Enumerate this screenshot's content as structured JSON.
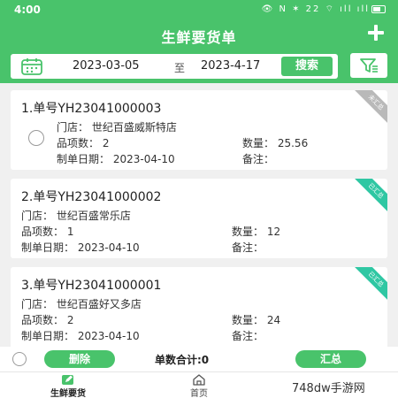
{
  "status_bar": {
    "time": "4:00",
    "icons_text": "👁 N ✶ 22 ⌔ ıll ıll"
  },
  "header": {
    "title": "生鲜要货单",
    "add_icon": "plus-icon"
  },
  "search": {
    "start_date": "2023-03-05",
    "separator": "至",
    "end_date": "2023-4-17",
    "button_label": "搜索",
    "calendar_icon": "calendar-icon",
    "filter_icon": "filter-icon"
  },
  "orders": [
    {
      "title": "1.单号YH23041000003",
      "store_label": "门店：",
      "store": "世纪百盛威斯特店",
      "items_label": "品项数：",
      "items": "2",
      "qty_label": "数量：",
      "qty": "25.56",
      "date_label": "制单日期：",
      "date": "2023-04-10",
      "note_label": "备注：",
      "note": "",
      "ribbon": "未汇总",
      "ribbon_color": "#b9b9b9",
      "has_radio": true
    },
    {
      "title": "2.单号YH23041000002",
      "store_label": "门店：",
      "store": "世纪百盛常乐店",
      "items_label": "品项数：",
      "items": "1",
      "qty_label": "数量：",
      "qty": "12",
      "date_label": "制单日期：",
      "date": "2023-04-10",
      "note_label": "备注：",
      "note": "",
      "ribbon": "已汇总",
      "ribbon_color": "#2fc7a3",
      "has_radio": false
    },
    {
      "title": "3.单号YH23041000001",
      "store_label": "门店：",
      "store": "世纪百盛好又多店",
      "items_label": "品项数：",
      "items": "2",
      "qty_label": "数量：",
      "qty": "24",
      "date_label": "制单日期：",
      "date": "2023-04-10",
      "note_label": "备注：",
      "note": "",
      "ribbon": "已汇总",
      "ribbon_color": "#2fc7a3",
      "has_radio": false
    }
  ],
  "action_bar": {
    "delete_label": "删除",
    "count_text": "单数合计:0",
    "summary_label": "汇总"
  },
  "tabs": [
    {
      "label": "生鲜要货",
      "icon": "edit-icon",
      "active": true
    },
    {
      "label": "首页",
      "icon": "home-icon",
      "active": false
    }
  ],
  "watermark": "748dw手游网",
  "colors": {
    "primary": "#49c36b",
    "ribbon_done": "#2fc7a3",
    "ribbon_pending": "#b9b9b9"
  }
}
